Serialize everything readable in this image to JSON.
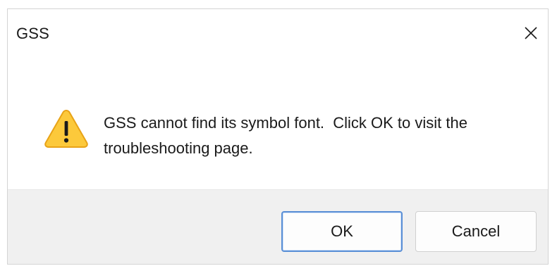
{
  "window": {
    "title": "GSS",
    "close_icon": "close-icon"
  },
  "message": {
    "icon": "warning-icon",
    "text_line1": "GSS cannot find its symbol font.  Click OK to visit the",
    "text_line2": "troubleshooting page."
  },
  "buttons": {
    "ok_label": "OK",
    "cancel_label": "Cancel"
  },
  "colors": {
    "warning_fill": "#fcc93b",
    "warning_stroke": "#e8a317",
    "footer_bg": "#f0f0f0",
    "default_button_border": "#5a8fd6"
  }
}
